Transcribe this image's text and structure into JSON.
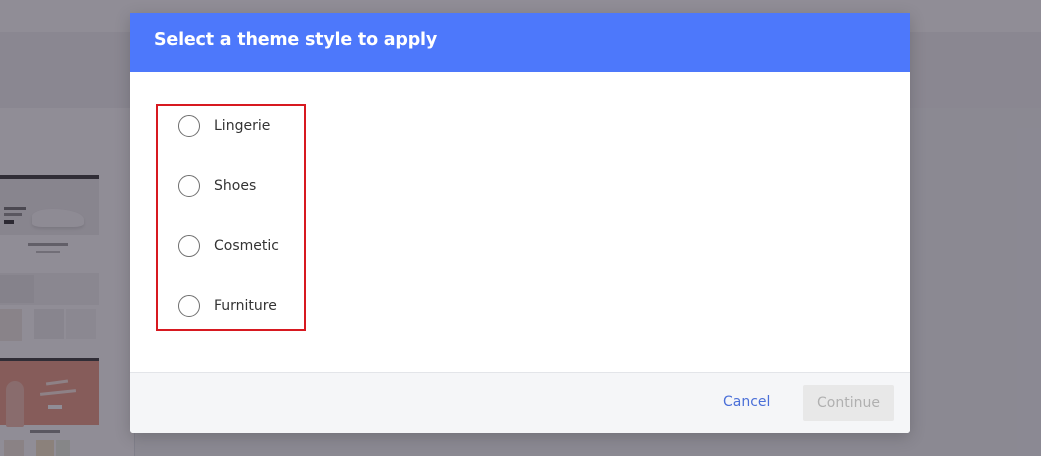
{
  "dialog": {
    "title": "Select a theme style to apply",
    "options": [
      {
        "label": "Lingerie",
        "selected": false
      },
      {
        "label": "Shoes",
        "selected": false
      },
      {
        "label": "Cosmetic",
        "selected": false
      },
      {
        "label": "Furniture",
        "selected": false
      }
    ],
    "cancel_label": "Cancel",
    "continue_label": "Continue",
    "continue_enabled": false
  },
  "colors": {
    "header_bg": "#4d78fb",
    "highlight_frame": "#d71920",
    "cancel_text": "#4a6fd8",
    "overlay": "rgba(52, 48, 64, 0.55)"
  },
  "icons": {
    "radio": "radio-circle-icon"
  }
}
